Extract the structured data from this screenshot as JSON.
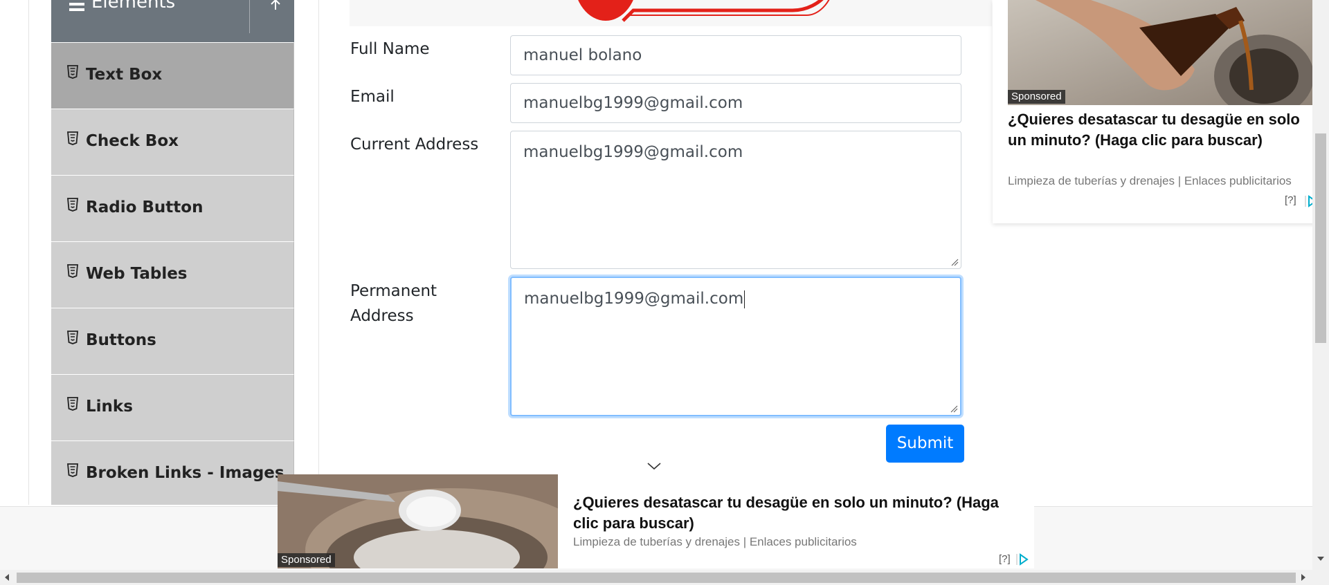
{
  "sidebar": {
    "group_title": "Elements",
    "items": [
      {
        "label": "Text Box",
        "active": true
      },
      {
        "label": "Check Box"
      },
      {
        "label": "Radio Button"
      },
      {
        "label": "Web Tables"
      },
      {
        "label": "Buttons"
      },
      {
        "label": "Links"
      },
      {
        "label": "Broken Links - Images"
      }
    ]
  },
  "form": {
    "full_name_label": "Full Name",
    "full_name_value": "manuel bolano",
    "email_label": "Email",
    "email_value": "manuelbg1999@gmail.com",
    "current_address_label": "Current Address",
    "current_address_value": "manuelbg1999@gmail.com",
    "permanent_address_label_line1": "Permanent",
    "permanent_address_label_line2": "Address",
    "permanent_address_value": "manuelbg1999@gmail.com",
    "submit_label": "Submit"
  },
  "right_ad": {
    "sponsored": "Sponsored",
    "title": "¿Quieres desatascar tu desagüe en solo un minuto? (Haga clic para buscar)",
    "source": "Limpieza de tuberías y drenajes | Enlaces publicitarios",
    "info": "[?]"
  },
  "bottom_ad": {
    "sponsored": "Sponsored",
    "title": "¿Quieres desatascar tu desagüe en solo un minuto? (Haga clic para buscar)",
    "source": "Limpieza de tuberías y drenajes | Enlaces publicitarios",
    "info": "[?]"
  },
  "colors": {
    "accent": "#007bff",
    "sidebar_header": "#6c757d",
    "menu_item": "#cfcfcf",
    "menu_item_active": "#a8a8a8"
  },
  "icons": [
    "menu-icon",
    "collapse-icon",
    "html5-icon",
    "chevron-down-icon",
    "adchoices-icon",
    "textarea-resize-icon"
  ]
}
